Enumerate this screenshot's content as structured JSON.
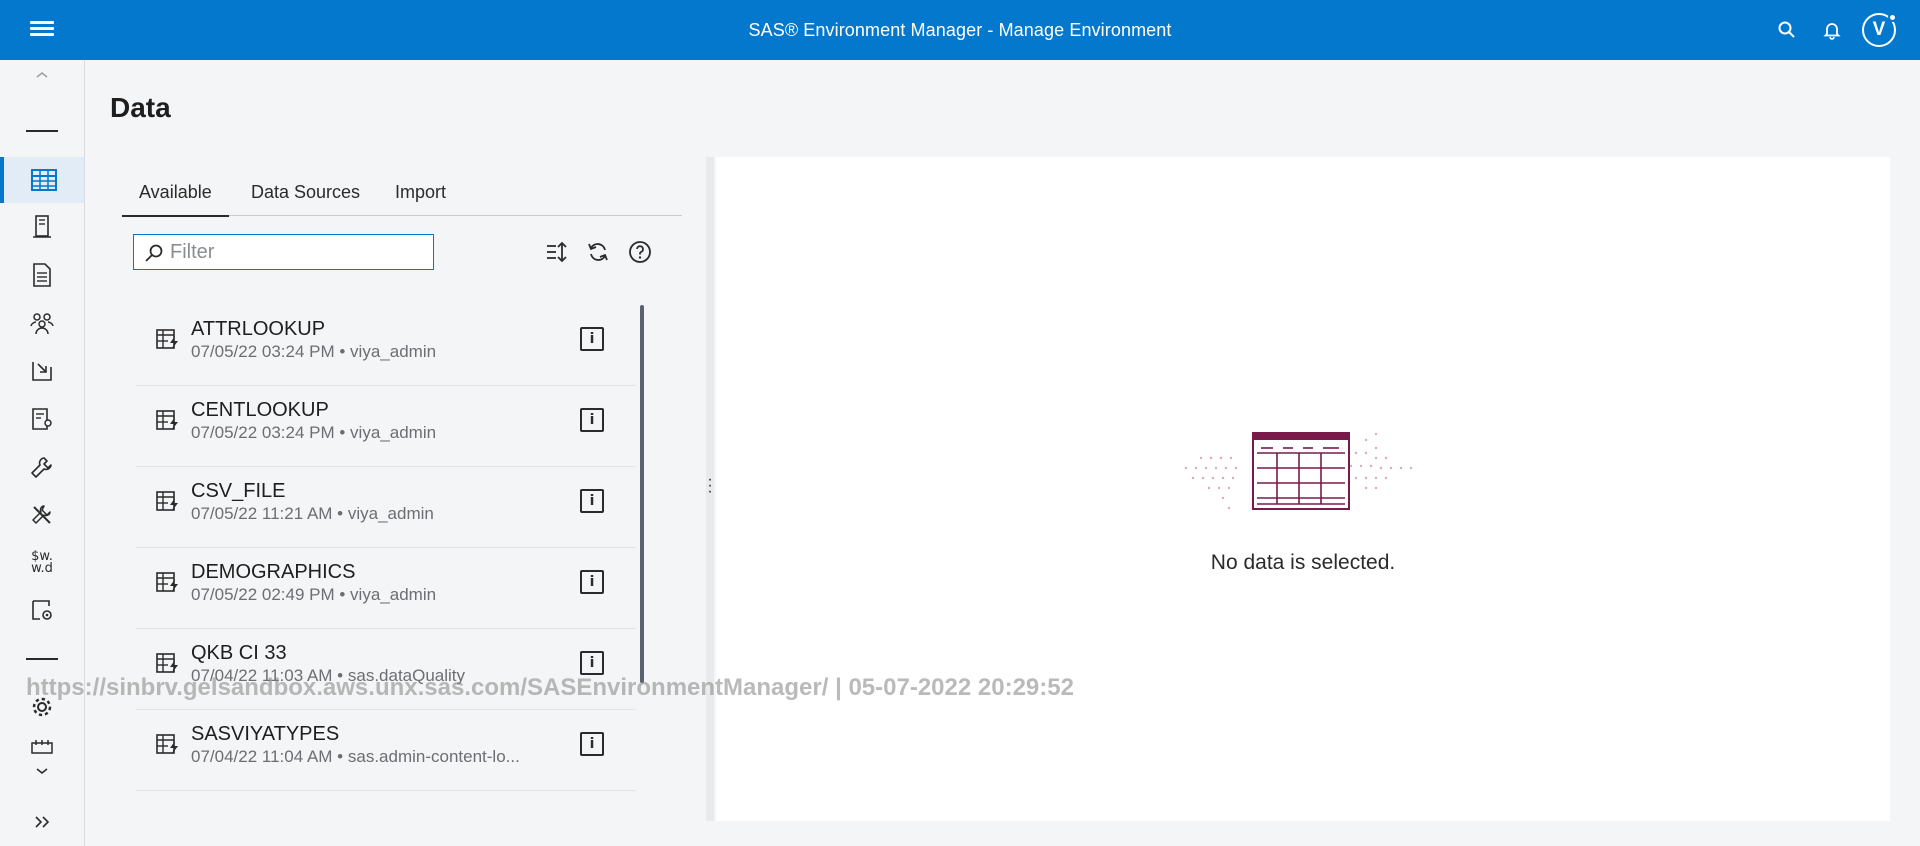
{
  "header": {
    "title": "SAS® Environment Manager - Manage Environment",
    "avatar_initial": "V",
    "menu_icon": "hamburger-menu-icon",
    "search_icon": "search-icon",
    "notifications_icon": "bell-icon"
  },
  "nav": {
    "items": [
      {
        "name": "data",
        "icon": "table-grid-icon",
        "active": true
      },
      {
        "name": "servers",
        "icon": "server-icon"
      },
      {
        "name": "content",
        "icon": "document-icon"
      },
      {
        "name": "users",
        "icon": "users-icon"
      },
      {
        "name": "import",
        "icon": "import-icon"
      },
      {
        "name": "reports",
        "icon": "report-settings-icon"
      },
      {
        "name": "tools",
        "icon": "wrench-icon"
      },
      {
        "name": "configuration",
        "icon": "tools-icon"
      },
      {
        "name": "formats",
        "icon": "formats-icon",
        "label_top": "$w.",
        "label_bottom": "w.d"
      },
      {
        "name": "jobs",
        "icon": "document-gear-icon"
      },
      {
        "name": "settings",
        "icon": "gear-icon"
      },
      {
        "name": "schedule",
        "icon": "calendar-icon"
      }
    ]
  },
  "page": {
    "title": "Data"
  },
  "tabs": [
    {
      "label": "Available",
      "active": true
    },
    {
      "label": "Data Sources"
    },
    {
      "label": "Import"
    }
  ],
  "filter": {
    "placeholder": "Filter",
    "value": ""
  },
  "toolbar": {
    "sort_icon": "sort-icon",
    "refresh_icon": "refresh-icon",
    "help_icon": "help-icon"
  },
  "tables": [
    {
      "name": "ATTRLOOKUP",
      "meta": "07/05/22 03:24 PM • viya_admin"
    },
    {
      "name": "CENTLOOKUP",
      "meta": "07/05/22 03:24 PM • viya_admin"
    },
    {
      "name": "CSV_FILE",
      "meta": "07/05/22 11:21 AM • viya_admin"
    },
    {
      "name": "DEMOGRAPHICS",
      "meta": "07/05/22 02:49 PM • viya_admin"
    },
    {
      "name": "QKB CI 33",
      "meta": "07/04/22 11:03 AM • sas.dataQuality"
    },
    {
      "name": "SASVIYATYPES",
      "meta": "07/04/22 11:04 AM • sas.admin-content-lo..."
    }
  ],
  "detail": {
    "empty_message": "No data is selected."
  },
  "watermark": "https://sinbrv.gelsandbox.aws.unx.sas.com/SASEnvironmentManager/ | 05-07-2022 20:29:52",
  "colors": {
    "accent": "#0378cd",
    "empty_illustration": "#7a1a4a"
  }
}
